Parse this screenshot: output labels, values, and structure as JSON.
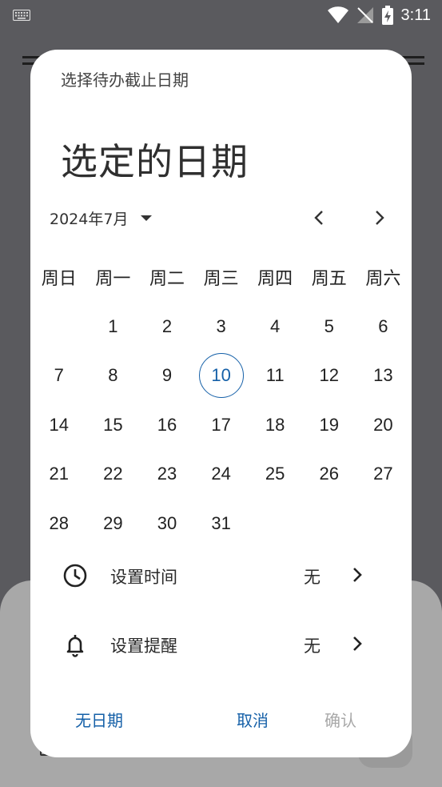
{
  "status": {
    "time": "3:11"
  },
  "dialog": {
    "title": "选择待办截止日期",
    "headline": "选定的日期",
    "month_label": "2024年7月",
    "weekdays": [
      "周日",
      "周一",
      "周二",
      "周三",
      "周四",
      "周五",
      "周六"
    ],
    "days": [
      "",
      "1",
      "2",
      "3",
      "4",
      "5",
      "6",
      "7",
      "8",
      "9",
      "10",
      "11",
      "12",
      "13",
      "14",
      "15",
      "16",
      "17",
      "18",
      "19",
      "20",
      "21",
      "22",
      "23",
      "24",
      "25",
      "26",
      "27",
      "28",
      "29",
      "30",
      "31"
    ],
    "today": "10",
    "time_setting": {
      "label": "设置时间",
      "value": "无",
      "icon": "clock-icon"
    },
    "reminder_setting": {
      "label": "设置提醒",
      "value": "无",
      "icon": "bell-icon"
    },
    "actions": {
      "no_date": "无日期",
      "cancel": "取消",
      "confirm": "确认"
    }
  },
  "colors": {
    "accent": "#1560a8",
    "disabled": "#a8a8a8",
    "scrim": "#5a5a5e"
  }
}
